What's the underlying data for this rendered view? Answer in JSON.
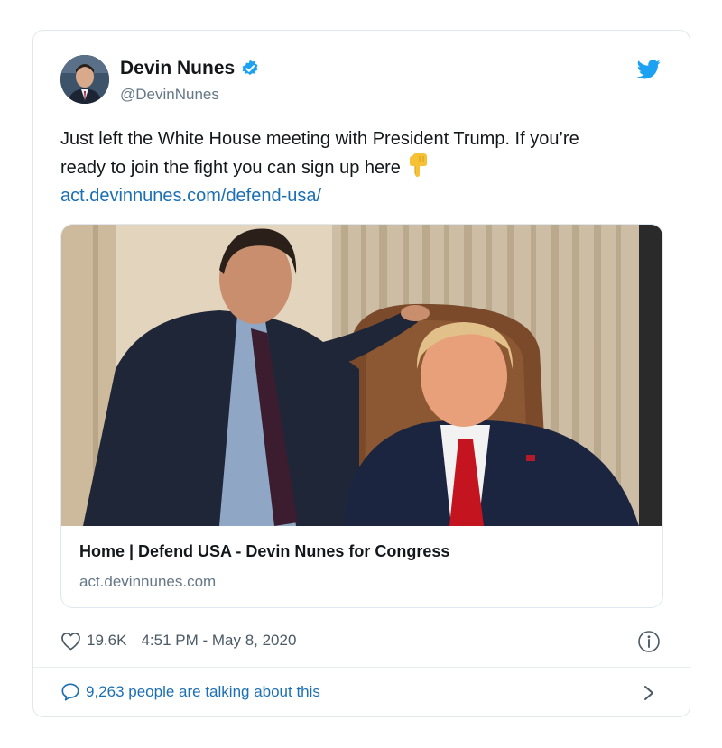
{
  "tweet": {
    "author": {
      "name": "Devin Nunes",
      "handle": "@DevinNunes",
      "verified": true
    },
    "text_line1": "Just left the White House meeting with President Trump. If you’re",
    "text_line2": "ready to join the fight you can sign up here",
    "emoji": "backhand-index-pointing-down",
    "link_text": "act.devinnunes.com/defend-usa/",
    "link_card": {
      "title": "Home | Defend USA - Devin Nunes for Congress",
      "domain": "act.devinnunes.com",
      "image_alt": "photo-two-men-in-office"
    },
    "likes": "19.6K",
    "timestamp": "4:51 PM - May 8, 2020",
    "talking": "9,263 people are talking about this"
  },
  "icons": {
    "brand": "twitter-bird-icon",
    "verified": "verified-badge-icon",
    "like": "heart-icon",
    "info": "info-icon",
    "comments": "speech-bubble-icon",
    "more": "chevron-right-icon"
  },
  "colors": {
    "twitter_blue": "#1da1f2",
    "link_blue": "#1b6fb3",
    "muted_text": "#657786",
    "border": "#e1e8ed"
  }
}
